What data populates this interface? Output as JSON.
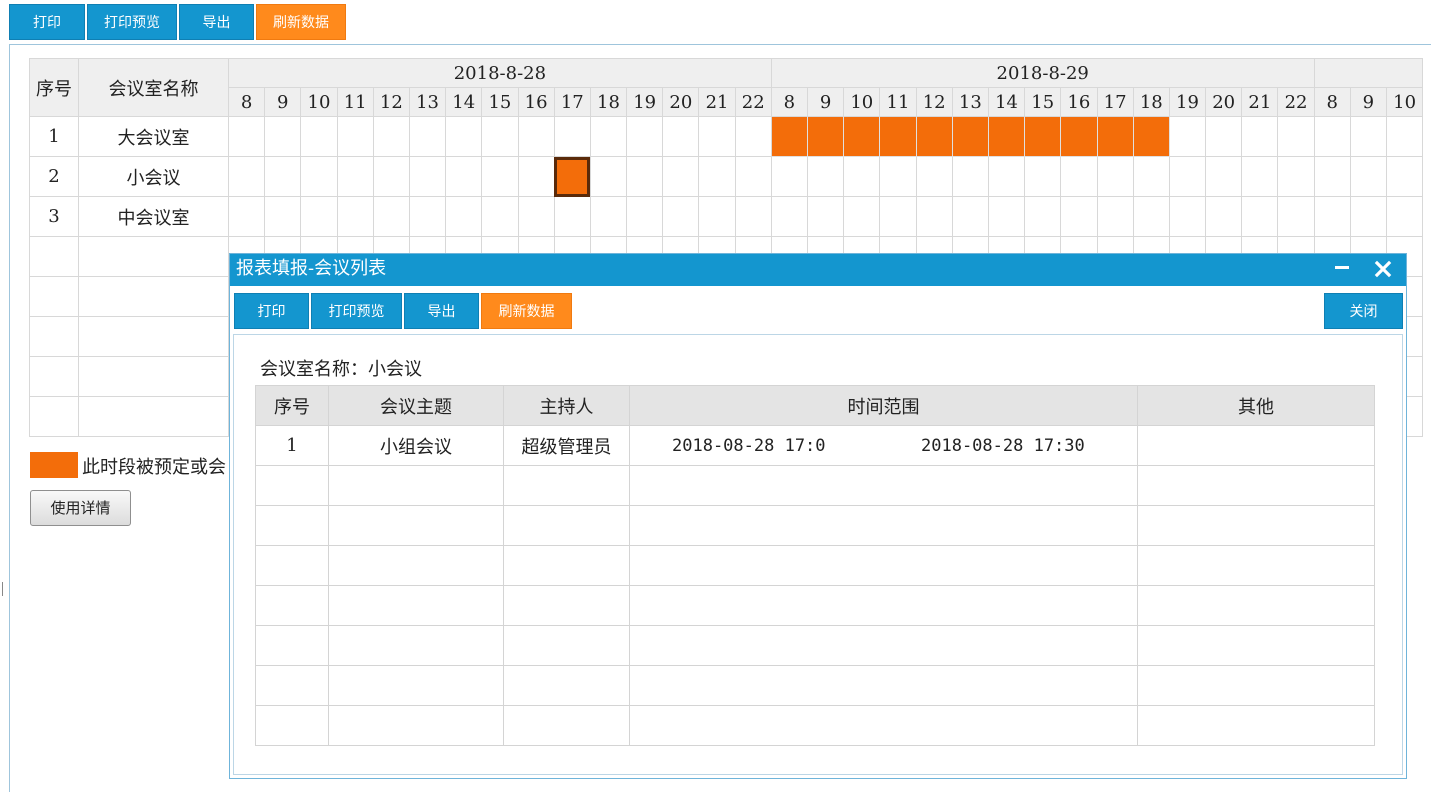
{
  "toolbar": {
    "print": "打印",
    "print_preview": "打印预览",
    "export": "导出",
    "refresh": "刷新数据"
  },
  "schedule": {
    "header_index": "序号",
    "header_room": "会议室名称",
    "dates": [
      "2018-8-28",
      "2018-8-29"
    ],
    "hours": [
      "8",
      "9",
      "10",
      "11",
      "12",
      "13",
      "14",
      "15",
      "16",
      "17",
      "18",
      "19",
      "20",
      "21",
      "22"
    ],
    "third_day_hours": [
      "8",
      "9",
      "10"
    ],
    "rooms": [
      {
        "index": "1",
        "name": "大会议室"
      },
      {
        "index": "2",
        "name": "小会议"
      },
      {
        "index": "3",
        "name": "中会议室"
      }
    ],
    "empty_rows": 5,
    "bookings": [
      {
        "room": 0,
        "day": 1,
        "from_hour": 8,
        "to_hour": 18
      },
      {
        "room": 1,
        "day": 0,
        "from_hour": 17,
        "to_hour": 17,
        "selected": true
      }
    ],
    "booked_color": "#f36d0a"
  },
  "legend": {
    "text": "此时段被预定或会"
  },
  "detail_button": "使用详情",
  "dialog": {
    "title": "报表填报-会议列表",
    "minimize_icon": "minimize-icon",
    "close_icon": "close-icon",
    "toolbar": {
      "print": "打印",
      "print_preview": "打印预览",
      "export": "导出",
      "refresh": "刷新数据",
      "close": "关闭"
    },
    "room_label": "会议室名称：小会议",
    "columns": [
      "序号",
      "会议主题",
      "主持人",
      "时间范围",
      "其他"
    ],
    "rows": [
      {
        "index": "1",
        "topic": "小组会议",
        "host": "超级管理员",
        "start": "2018-08-28 17:0",
        "end": "2018-08-28 17:30",
        "other": ""
      }
    ],
    "empty_rows": 7
  }
}
